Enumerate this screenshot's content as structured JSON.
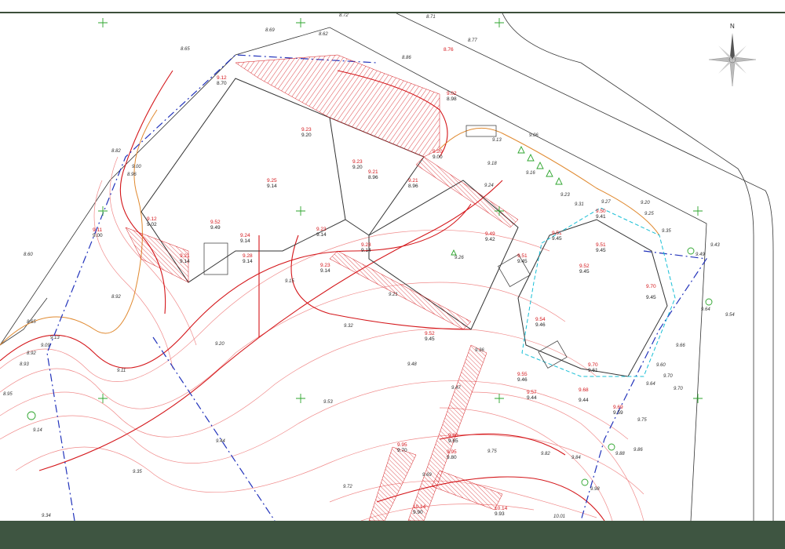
{
  "compass": {
    "north_label": "N"
  },
  "colors": {
    "frame": "#3e5541",
    "building": "#333333",
    "contour_major": "#d4161a",
    "contour_minor": "#f08a8a",
    "contour_orange": "#e0892f",
    "boundary": "#2233bb",
    "cyan_outline": "#18bfd6",
    "grid_cross": "#2da52d",
    "tree": "#2da52d"
  },
  "elevation_pairs": [
    {
      "red": "9.12",
      "black": "8.70"
    },
    {
      "red": "9.23",
      "black": "9.20"
    },
    {
      "red": "9.23",
      "black": "9.20"
    },
    {
      "red": "9.21",
      "black": "8.96"
    },
    {
      "red": "9.20",
      "black": "9.00"
    },
    {
      "red": "9.25",
      "black": "9.14"
    },
    {
      "red": "9.21",
      "black": "8.96"
    },
    {
      "red": "9.12",
      "black": "9.02"
    },
    {
      "red": "9.11",
      "black": "9.00"
    },
    {
      "red": "9.52",
      "black": "9.49"
    },
    {
      "red": "9.24",
      "black": "9.14"
    },
    {
      "red": "9.23",
      "black": "9.14"
    },
    {
      "red": "9.21",
      "black": "9.14"
    },
    {
      "red": "9.28",
      "black": "9.14"
    },
    {
      "red": "9.23",
      "black": "9.14"
    },
    {
      "red": "9.23",
      "black": "9.14"
    },
    {
      "red": "9.49",
      "black": "9.42"
    },
    {
      "red": "9.51",
      "black": "9.45"
    },
    {
      "red": "9.51",
      "black": "9.45"
    },
    {
      "red": "9.51",
      "black": "9.45"
    },
    {
      "red": "9.52",
      "black": "9.45"
    },
    {
      "red": "9.70",
      "black": "9.45"
    },
    {
      "red": "9.52",
      "black": "9.45"
    },
    {
      "red": "9.54",
      "black": "9.46"
    },
    {
      "red": "9.55",
      "black": "9.46"
    },
    {
      "red": "9.57",
      "black": "9.44"
    },
    {
      "red": "9.68",
      "black": "9.44"
    },
    {
      "red": "9.70",
      "black": "9.61"
    },
    {
      "red": "9.69",
      "black": "9.59"
    },
    {
      "red": "9.50",
      "black": "9.41"
    },
    {
      "red": "9.02",
      "black": "8.98"
    },
    {
      "red": "9.95",
      "black": "9.70"
    },
    {
      "red": "9.80",
      "black": "9.65"
    },
    {
      "red": "9.95",
      "black": "9.80"
    },
    {
      "red": "10.14",
      "black": "9.90"
    },
    {
      "red": "10.14",
      "black": "9.93"
    }
  ],
  "spot_heights": [
    "8.72",
    "8.71",
    "8.77",
    "8.69",
    "8.62",
    "8.65",
    "8.86",
    "8.76",
    "8.82",
    "8.60",
    "8.92",
    "8.65",
    "9.09",
    "9.13",
    "8.92",
    "8.93",
    "8.95",
    "9.14",
    "9.11",
    "9.20",
    "9.32",
    "9.15",
    "9.21",
    "9.26",
    "9.48",
    "9.47",
    "9.36",
    "9.53",
    "9.44",
    "9.35",
    "9.34",
    "9.72",
    "9.69",
    "9.75",
    "9.82",
    "9.84",
    "9.88",
    "9.86",
    "9.98",
    "10.01",
    "9.06",
    "9.13",
    "9.18",
    "9.16",
    "9.23",
    "9.31",
    "9.27",
    "9.25",
    "9.35",
    "9.20",
    "9.43",
    "9.49",
    "9.54",
    "9.64",
    "9.66",
    "9.60",
    "9.64",
    "9.70",
    "9.70",
    "9.75",
    "9.24",
    "8.96",
    "9.00"
  ]
}
